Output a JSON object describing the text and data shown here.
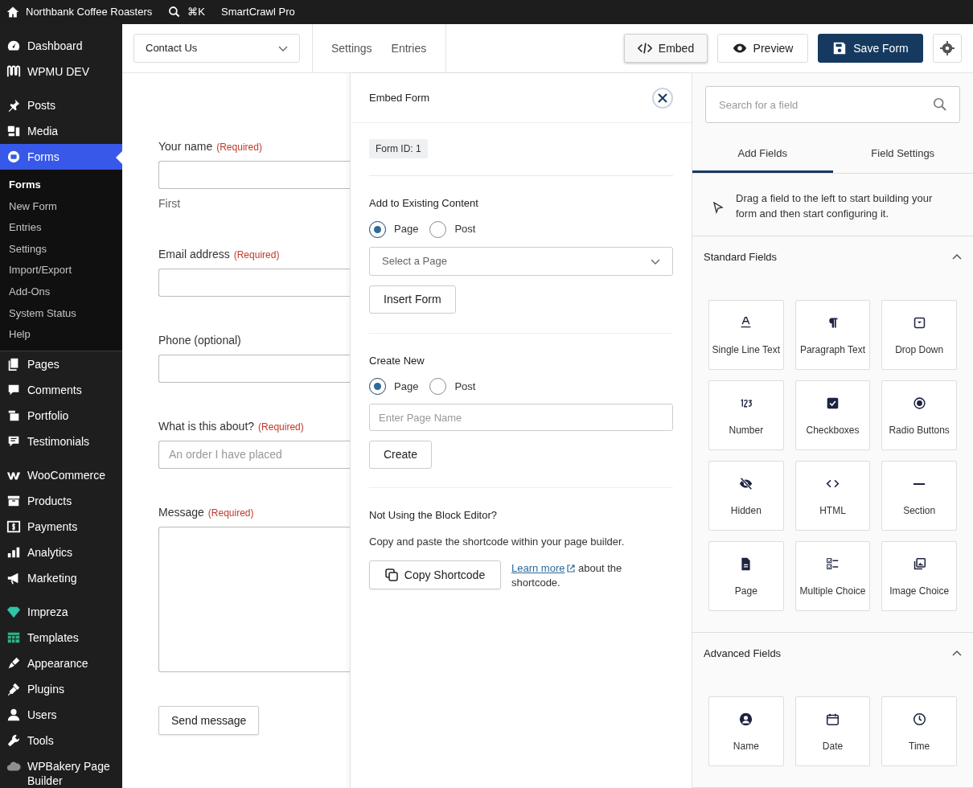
{
  "top_bar": {
    "site_name": "Northbank Coffee Roasters",
    "shortcut": "⌘K",
    "plugin": "SmartCrawl Pro"
  },
  "sidebar": {
    "groups": [
      [
        {
          "label": "Dashboard",
          "selected": false
        },
        {
          "label": "WPMU DEV",
          "selected": false
        }
      ],
      [
        {
          "label": "Posts",
          "selected": false
        },
        {
          "label": "Media",
          "selected": false
        },
        {
          "label": "Forms",
          "selected": true,
          "submenu": [
            {
              "label": "Forms",
              "selected": true
            },
            {
              "label": "New Form",
              "selected": false
            },
            {
              "label": "Entries",
              "selected": false
            },
            {
              "label": "Settings",
              "selected": false
            },
            {
              "label": "Import/Export",
              "selected": false
            },
            {
              "label": "Add-Ons",
              "selected": false
            },
            {
              "label": "System Status",
              "selected": false
            },
            {
              "label": "Help",
              "selected": false
            }
          ]
        },
        {
          "label": "Pages",
          "selected": false
        },
        {
          "label": "Comments",
          "selected": false
        },
        {
          "label": "Portfolio",
          "selected": false
        },
        {
          "label": "Testimonials",
          "selected": false
        }
      ],
      [
        {
          "label": "WooCommerce",
          "selected": false
        },
        {
          "label": "Products",
          "selected": false
        },
        {
          "label": "Payments",
          "selected": false
        },
        {
          "label": "Analytics",
          "selected": false
        },
        {
          "label": "Marketing",
          "selected": false
        }
      ],
      [
        {
          "label": "Impreza",
          "selected": false
        },
        {
          "label": "Templates",
          "selected": false
        },
        {
          "label": "Appearance",
          "selected": false
        },
        {
          "label": "Plugins",
          "selected": false
        },
        {
          "label": "Users",
          "selected": false
        },
        {
          "label": "Tools",
          "selected": false
        },
        {
          "label": "WPBakery Page Builder",
          "selected": false
        }
      ]
    ]
  },
  "header": {
    "form_select": "Contact Us",
    "links": [
      "Settings",
      "Entries"
    ],
    "buttons": [
      {
        "label": "Embed",
        "kind": "embed",
        "active": true
      },
      {
        "label": "Preview",
        "kind": "preview",
        "active": false
      },
      {
        "label": "Save Form",
        "kind": "save"
      }
    ]
  },
  "form": {
    "fields": [
      {
        "label": "Your name",
        "required": "(Required)",
        "kind": "input",
        "sublabel": "First"
      },
      {
        "label": "Email address",
        "required": "(Required)",
        "kind": "input"
      },
      {
        "label": "Phone (optional)",
        "kind": "input"
      },
      {
        "label": "What is this about?",
        "required": "(Required)",
        "kind": "select",
        "placeholder": "An order I have placed"
      },
      {
        "label": "Message",
        "required": "(Required)",
        "kind": "textarea"
      }
    ],
    "submit": "Send message"
  },
  "embed_panel": {
    "title": "Embed Form",
    "form_id": "Form ID: 1",
    "existing": {
      "heading": "Add to Existing Content",
      "options": [
        {
          "label": "Page",
          "selected": true
        },
        {
          "label": "Post",
          "selected": false
        }
      ],
      "select_placeholder": "Select a Page",
      "button": "Insert Form"
    },
    "create": {
      "heading": "Create New",
      "options": [
        {
          "label": "Page",
          "selected": true
        },
        {
          "label": "Post",
          "selected": false
        }
      ],
      "placeholder": "Enter Page Name",
      "button": "Create"
    },
    "shortcode": {
      "heading": "Not Using the Block Editor?",
      "text": "Copy and paste the shortcode within your page builder.",
      "button": "Copy Shortcode",
      "link": "Learn more",
      "after_link": "about the shortcode."
    }
  },
  "fields_panel": {
    "search_placeholder": "Search for a field",
    "tabs": [
      {
        "label": "Add Fields",
        "selected": true
      },
      {
        "label": "Field Settings",
        "selected": false
      }
    ],
    "hint": "Drag a field to the left to start building your form and then start configuring it.",
    "sections": [
      {
        "title": "Standard Fields",
        "expanded": true,
        "fields": [
          "Single Line Text",
          "Paragraph Text",
          "Drop Down",
          "Number",
          "Checkboxes",
          "Radio Buttons",
          "Hidden",
          "HTML",
          "Section",
          "Page",
          "Multiple Choice",
          "Image Choice"
        ]
      },
      {
        "title": "Advanced Fields",
        "expanded": true,
        "fields": [
          "Name",
          "Date",
          "Time"
        ]
      }
    ]
  }
}
